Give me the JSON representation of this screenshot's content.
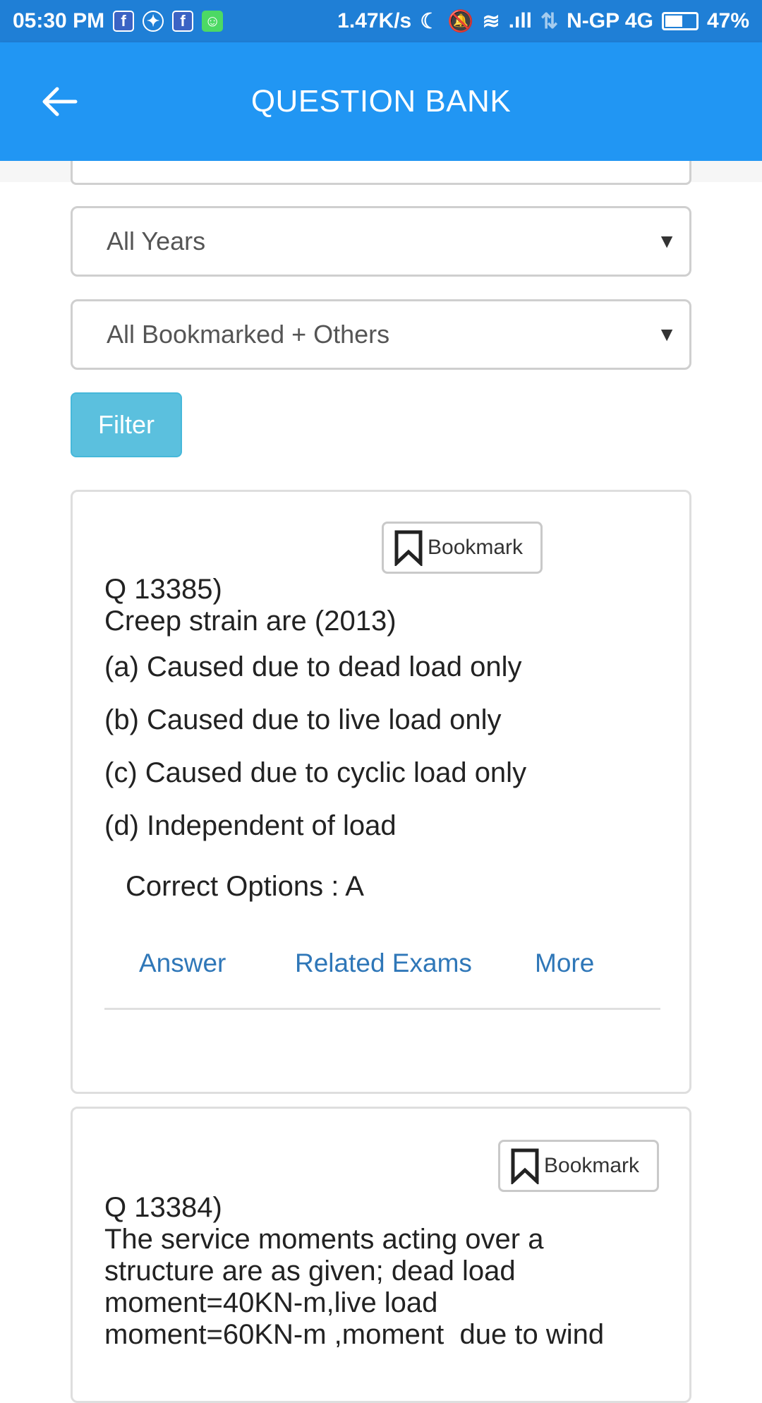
{
  "status_bar": {
    "time": "05:30 PM",
    "network_speed": "1.47K/s",
    "carrier": "N-GP 4G",
    "battery_percent": "47%",
    "battery_level": 0.47
  },
  "app_bar": {
    "title": "QUESTION BANK"
  },
  "filters": {
    "year_select": "All Years",
    "bookmark_select": "All Bookmarked + Others",
    "filter_button": "Filter"
  },
  "questions": [
    {
      "bookmark_label": "Bookmark",
      "number": "Q 13385)",
      "text": "Creep strain are (2013)",
      "options": [
        "(a) Caused due to dead load only",
        "(b) Caused due to live load only",
        "(c) Caused due to cyclic load only",
        "(d) Independent of load"
      ],
      "correct": "Correct Options : A",
      "links": {
        "answer": "Answer",
        "related": "Related Exams",
        "more": "More"
      }
    },
    {
      "bookmark_label": "Bookmark",
      "number": "Q 13384)",
      "text_lines": [
        "The service moments acting over a",
        "structure are as given; dead load",
        "moment=40KN-m,live load",
        "moment=60KN-m ,moment  due to wind"
      ]
    }
  ],
  "colors": {
    "status_bar": "#1f7fd6",
    "app_bar": "#2196f3",
    "filter_button": "#5bc0de",
    "link": "#2f77b8"
  }
}
